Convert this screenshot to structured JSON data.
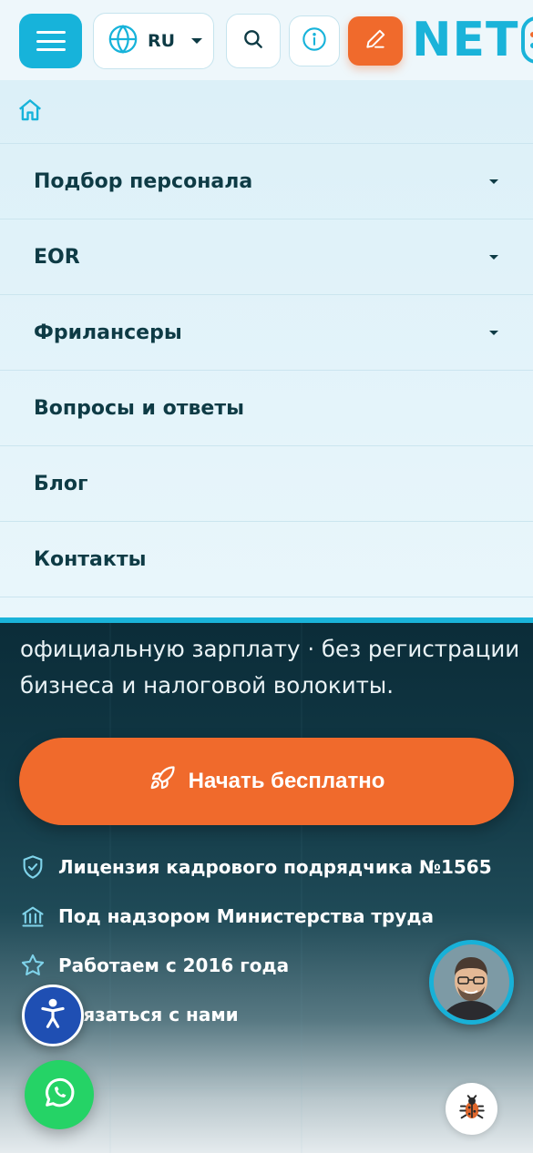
{
  "header": {
    "language": "RU",
    "logo_text": "NET"
  },
  "menu": {
    "items": [
      {
        "label": "Подбор персонала",
        "has_submenu": true
      },
      {
        "label": "EOR",
        "has_submenu": true
      },
      {
        "label": "Фрилансеры",
        "has_submenu": true
      },
      {
        "label": "Вопросы и ответы",
        "has_submenu": false
      },
      {
        "label": "Блог",
        "has_submenu": false
      },
      {
        "label": "Контакты",
        "has_submenu": false
      }
    ]
  },
  "hero": {
    "line1": "официальную зарплату · без регистрации",
    "line2": "бизнеса и налоговой волокиты.",
    "cta_label": "Начать бесплатно",
    "features": [
      {
        "icon": "shield-check-icon",
        "text": "Лицензия кадрового подрядчика №1565"
      },
      {
        "icon": "bank-icon",
        "text": "Под надзором Министерства труда"
      },
      {
        "icon": "star-icon",
        "text": "Работаем с 2016 года"
      },
      {
        "icon": "chat-icon",
        "text": "Связаться с нами"
      }
    ]
  },
  "colors": {
    "accent": "#17b3da",
    "cta": "#f06a2c",
    "text_dark": "#0e3b45",
    "whatsapp": "#25d366",
    "accessibility": "#1f4fb3"
  }
}
